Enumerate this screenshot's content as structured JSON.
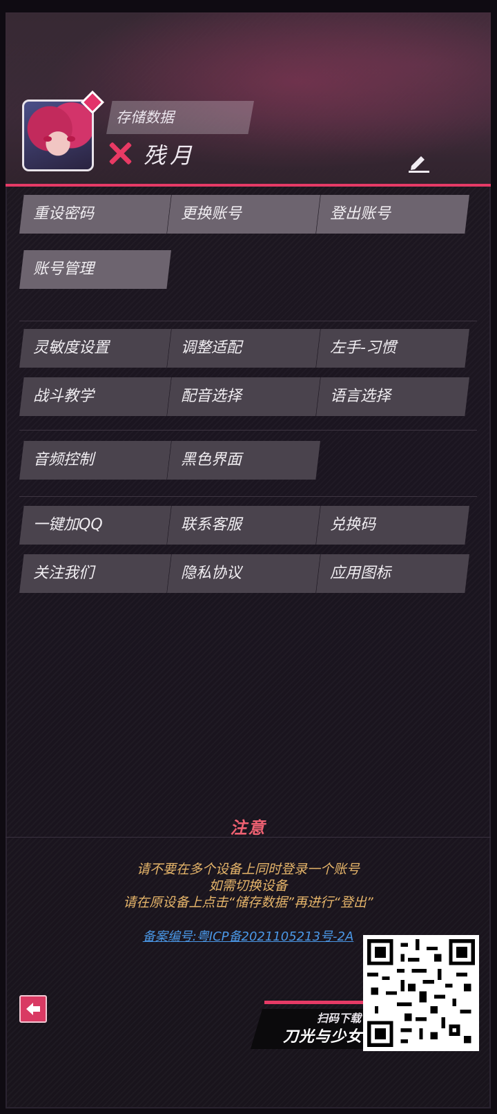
{
  "header": {
    "save_label": "存储数据",
    "player_name": "残月"
  },
  "groups": {
    "account": [
      "重设密码",
      "更换账号",
      "登出账号",
      "账号管理"
    ],
    "settings": [
      "灵敏度设置",
      "调整适配",
      "左手-习惯",
      "战斗教学",
      "配音选择",
      "语言选择"
    ],
    "display": [
      "音频控制",
      "黑色界面"
    ],
    "other": [
      "一键加QQ",
      "联系客服",
      "兑换码",
      "关注我们",
      "隐私协议",
      "应用图标"
    ]
  },
  "notice": {
    "title": "注意",
    "lines": [
      "请不要在多个设备上同时登录一个账号",
      "如需切换设备",
      "请在原设备上点击“储存数据”再进行“登出”"
    ]
  },
  "icp": "备案编号:粤ICP备2021105213号-2A",
  "promo": {
    "scan_label": "扫码下载",
    "game_logo": "刀光与少女"
  },
  "icons": [
    "avatar",
    "x-mark-icon",
    "edit-icon",
    "back-arrow-icon",
    "qr-code"
  ],
  "colors": {
    "accent": "#e53a66",
    "notice_title": "#ef6172",
    "notice_text": "#e6b56a",
    "link": "#4a97e6"
  }
}
